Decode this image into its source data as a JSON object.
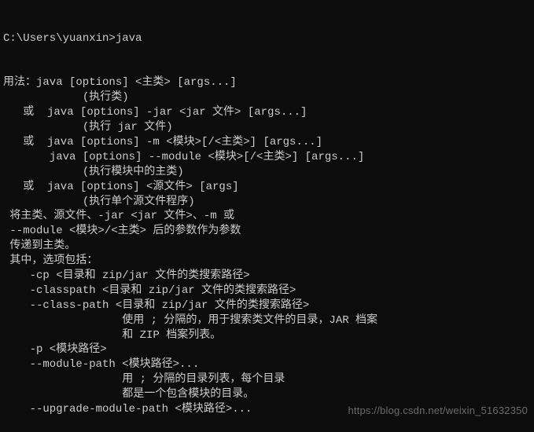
{
  "prompt": "C:\\Users\\yuanxin>java",
  "lines": [
    "用法：java [options] <主类> [args...]",
    "            (执行类)",
    "   或  java [options] -jar <jar 文件> [args...]",
    "            (执行 jar 文件)",
    "   或  java [options] -m <模块>[/<主类>] [args...]",
    "       java [options] --module <模块>[/<主类>] [args...]",
    "            (执行模块中的主类)",
    "   或  java [options] <源文件> [args]",
    "            (执行单个源文件程序)",
    "",
    " 将主类、源文件、-jar <jar 文件>、-m 或",
    " --module <模块>/<主类> 后的参数作为参数",
    " 传递到主类。",
    "",
    " 其中，选项包括：",
    "",
    "    -cp <目录和 zip/jar 文件的类搜索路径>",
    "    -classpath <目录和 zip/jar 文件的类搜索路径>",
    "    --class-path <目录和 zip/jar 文件的类搜索路径>",
    "                  使用 ; 分隔的，用于搜索类文件的目录，JAR 档案",
    "                  和 ZIP 档案列表。",
    "    -p <模块路径>",
    "    --module-path <模块路径>...",
    "                  用 ; 分隔的目录列表，每个目录",
    "                  都是一个包含模块的目录。",
    "    --upgrade-module-path <模块路径>..."
  ],
  "watermark": "https://blog.csdn.net/weixin_51632350"
}
